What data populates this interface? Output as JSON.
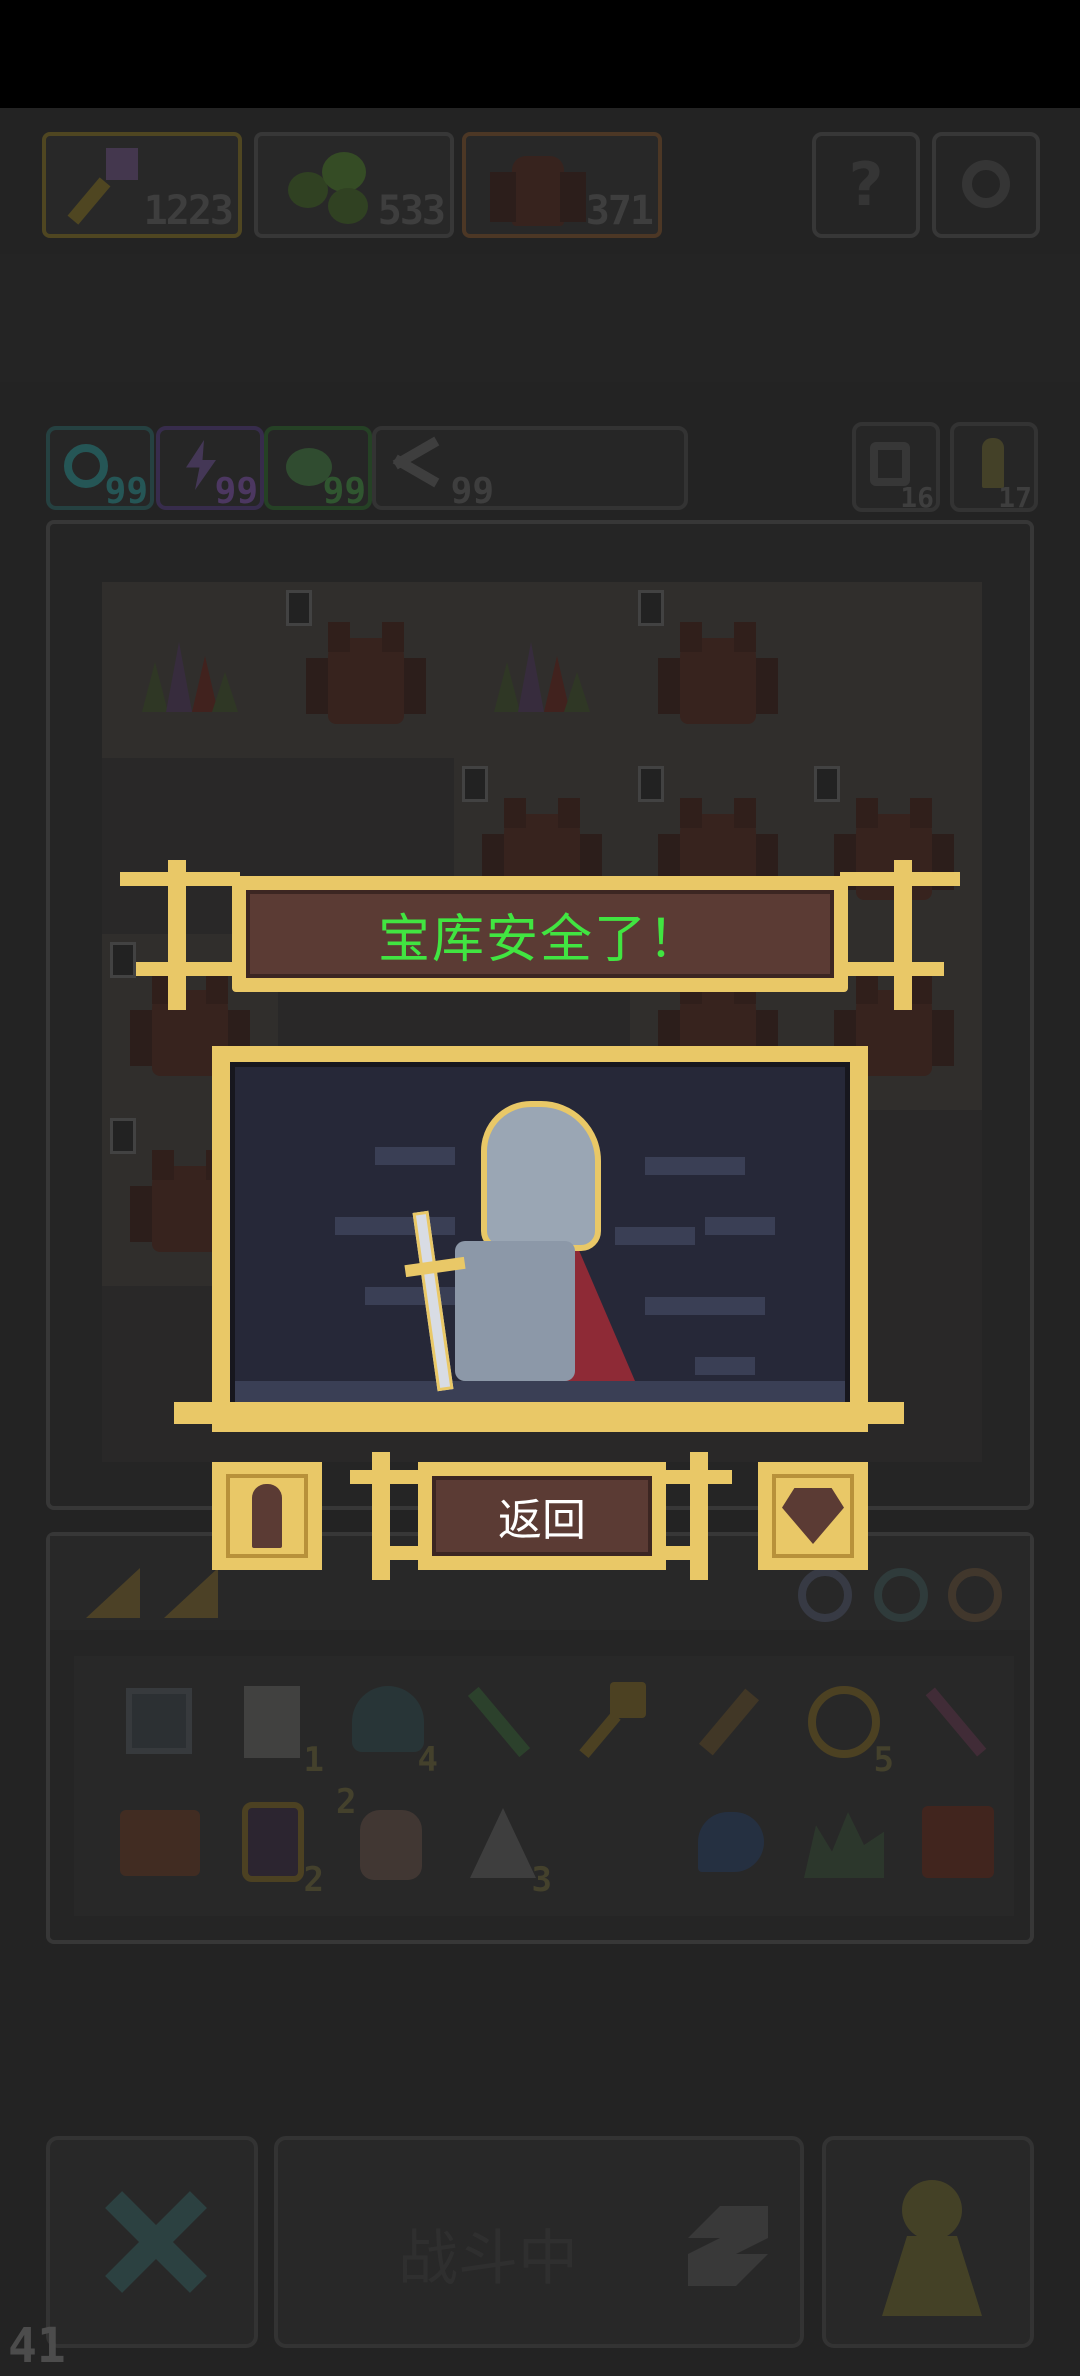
{
  "resources": [
    {
      "name": "key",
      "value": "1223",
      "color": "#8a7a2e"
    },
    {
      "name": "slime",
      "value": "533",
      "color": "#4a4a4a"
    },
    {
      "name": "demon",
      "value": "371",
      "color": "#7a4a2e"
    }
  ],
  "top_buttons": {
    "help_label": "?",
    "settings_icon": "gear-icon"
  },
  "boosts": [
    {
      "icon": "spiral-icon",
      "value": "99",
      "color": "#2f7a7a"
    },
    {
      "icon": "lightning-icon",
      "value": "99",
      "color": "#6a4a8a"
    },
    {
      "icon": "blob-icon",
      "value": "99",
      "color": "#3f7a3f"
    },
    {
      "icon": "scissors-icon",
      "value": "99",
      "color": "#555555"
    }
  ],
  "right_counters": [
    {
      "icon": "cycle-icon",
      "value": "16"
    },
    {
      "icon": "pawn-icon",
      "value": "17"
    }
  ],
  "dialog": {
    "title": "宝库安全了！",
    "back_label": "返回",
    "title_color": "#41e541",
    "frame_color": "#e9c867"
  },
  "inventory": {
    "row1": [
      {
        "icon": "map-tile-icon",
        "count": ""
      },
      {
        "icon": "scroll-icon",
        "count": "1"
      },
      {
        "icon": "heart-shield-icon",
        "count": "4"
      },
      {
        "icon": "green-dart-icon",
        "count": ""
      },
      {
        "icon": "purple-key-icon",
        "count": ""
      },
      {
        "icon": "torch-icon",
        "count": ""
      },
      {
        "icon": "ring-icon",
        "count": "5"
      },
      {
        "icon": "pickaxe-icon",
        "count": ""
      }
    ],
    "row2": [
      {
        "icon": "chest-lightning-icon",
        "count": ""
      },
      {
        "icon": "potion-card-icon",
        "count": "2"
      },
      {
        "icon": "hand-icon",
        "count": "2"
      },
      {
        "icon": "claw-icon",
        "count": "3"
      },
      {
        "icon": "",
        "count": ""
      },
      {
        "icon": "blue-bird-icon",
        "count": ""
      },
      {
        "icon": "crystal-icon",
        "count": ""
      },
      {
        "icon": "fire-box-icon",
        "count": ""
      }
    ]
  },
  "bottom": {
    "battle_label": "战斗中",
    "fps": "41"
  }
}
